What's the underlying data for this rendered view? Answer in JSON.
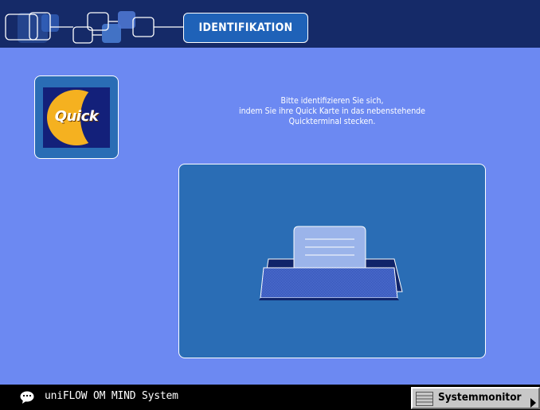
{
  "header": {
    "title": "IDENTIFIKATION",
    "decoration_icon": "connected-squares-icon"
  },
  "main": {
    "quick_logo": {
      "text": "Quick",
      "icon": "quick-logo-icon",
      "colors": {
        "disc": "#f5b120",
        "background": "#13207a"
      }
    },
    "instructions": [
      "Bitte identifizieren Sie sich,",
      "indem Sie ihre Quick Karte in das nebenstehende",
      "Quickterminal stecken."
    ],
    "terminal_icon": "card-terminal-icon"
  },
  "footer": {
    "system_icon": "chat-bubble-icon",
    "system_name": "uniFLOW OM MIND System",
    "system_monitor_label": "Systemmonitor",
    "system_monitor_icon": "monitor-lines-icon"
  },
  "colors": {
    "header_bg": "#152a68",
    "content_bg": "#6c89f2",
    "panel_bg": "#2a6db5",
    "tab_bg": "#1f62b8",
    "footer_bg": "#000000",
    "button_bg": "#c8c8c8"
  }
}
